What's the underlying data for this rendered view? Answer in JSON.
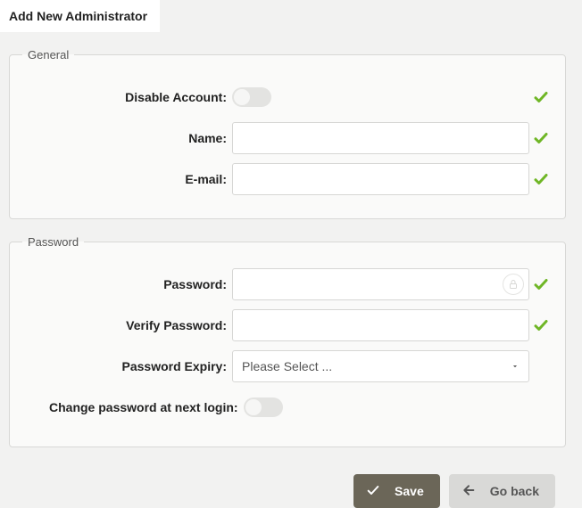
{
  "tab": {
    "title": "Add New Administrator"
  },
  "general": {
    "legend": "General",
    "disable_label": "Disable Account:",
    "name_label": "Name:",
    "name_value": "",
    "email_label": "E-mail:",
    "email_value": ""
  },
  "password": {
    "legend": "Password",
    "password_label": "Password:",
    "password_value": "",
    "verify_label": "Verify Password:",
    "verify_value": "",
    "expiry_label": "Password Expiry:",
    "expiry_selected": "Please Select ...",
    "change_next_login_label": "Change password at next login:"
  },
  "footer": {
    "save_label": "Save",
    "back_label": "Go back"
  },
  "colors": {
    "accent_check": "#6fb626",
    "primary_btn": "#6b6658",
    "secondary_btn": "#d9d9d7"
  }
}
